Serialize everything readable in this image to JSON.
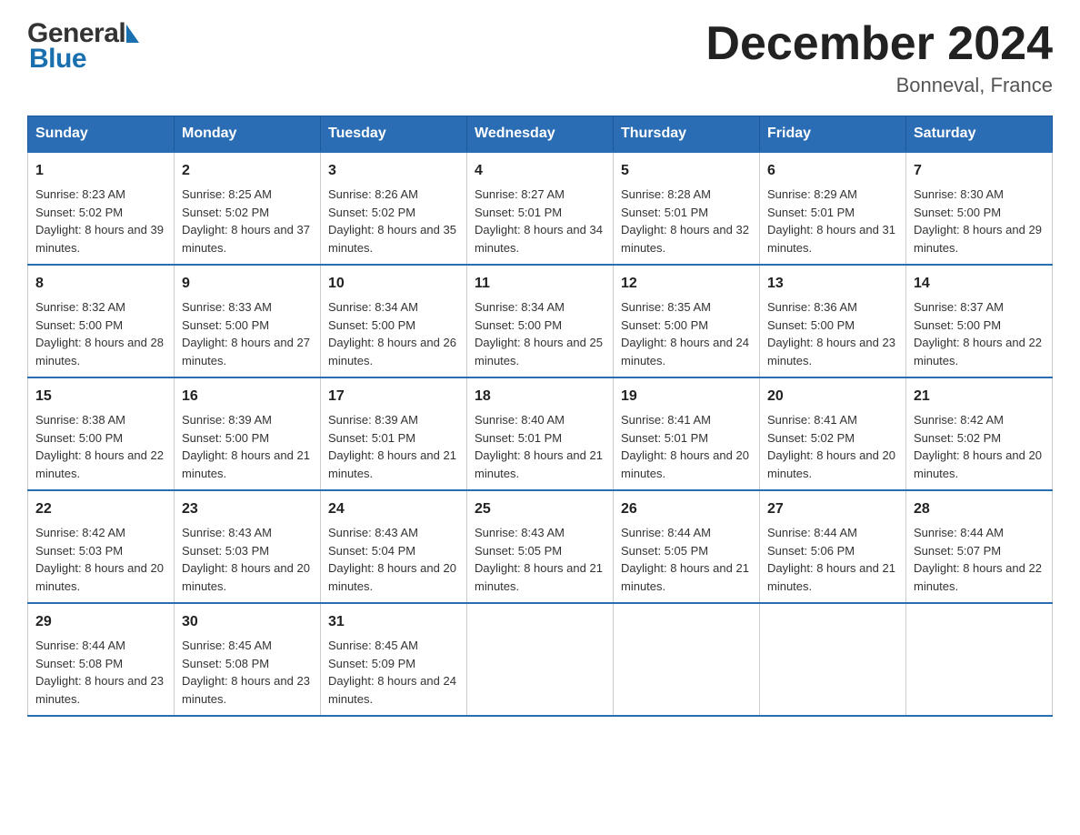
{
  "header": {
    "logo_general": "General",
    "logo_blue": "Blue",
    "title": "December 2024",
    "location": "Bonneval, France"
  },
  "calendar": {
    "days": [
      "Sunday",
      "Monday",
      "Tuesday",
      "Wednesday",
      "Thursday",
      "Friday",
      "Saturday"
    ],
    "weeks": [
      [
        {
          "day": "1",
          "sunrise": "8:23 AM",
          "sunset": "5:02 PM",
          "daylight": "8 hours and 39 minutes."
        },
        {
          "day": "2",
          "sunrise": "8:25 AM",
          "sunset": "5:02 PM",
          "daylight": "8 hours and 37 minutes."
        },
        {
          "day": "3",
          "sunrise": "8:26 AM",
          "sunset": "5:02 PM",
          "daylight": "8 hours and 35 minutes."
        },
        {
          "day": "4",
          "sunrise": "8:27 AM",
          "sunset": "5:01 PM",
          "daylight": "8 hours and 34 minutes."
        },
        {
          "day": "5",
          "sunrise": "8:28 AM",
          "sunset": "5:01 PM",
          "daylight": "8 hours and 32 minutes."
        },
        {
          "day": "6",
          "sunrise": "8:29 AM",
          "sunset": "5:01 PM",
          "daylight": "8 hours and 31 minutes."
        },
        {
          "day": "7",
          "sunrise": "8:30 AM",
          "sunset": "5:00 PM",
          "daylight": "8 hours and 29 minutes."
        }
      ],
      [
        {
          "day": "8",
          "sunrise": "8:32 AM",
          "sunset": "5:00 PM",
          "daylight": "8 hours and 28 minutes."
        },
        {
          "day": "9",
          "sunrise": "8:33 AM",
          "sunset": "5:00 PM",
          "daylight": "8 hours and 27 minutes."
        },
        {
          "day": "10",
          "sunrise": "8:34 AM",
          "sunset": "5:00 PM",
          "daylight": "8 hours and 26 minutes."
        },
        {
          "day": "11",
          "sunrise": "8:34 AM",
          "sunset": "5:00 PM",
          "daylight": "8 hours and 25 minutes."
        },
        {
          "day": "12",
          "sunrise": "8:35 AM",
          "sunset": "5:00 PM",
          "daylight": "8 hours and 24 minutes."
        },
        {
          "day": "13",
          "sunrise": "8:36 AM",
          "sunset": "5:00 PM",
          "daylight": "8 hours and 23 minutes."
        },
        {
          "day": "14",
          "sunrise": "8:37 AM",
          "sunset": "5:00 PM",
          "daylight": "8 hours and 22 minutes."
        }
      ],
      [
        {
          "day": "15",
          "sunrise": "8:38 AM",
          "sunset": "5:00 PM",
          "daylight": "8 hours and 22 minutes."
        },
        {
          "day": "16",
          "sunrise": "8:39 AM",
          "sunset": "5:00 PM",
          "daylight": "8 hours and 21 minutes."
        },
        {
          "day": "17",
          "sunrise": "8:39 AM",
          "sunset": "5:01 PM",
          "daylight": "8 hours and 21 minutes."
        },
        {
          "day": "18",
          "sunrise": "8:40 AM",
          "sunset": "5:01 PM",
          "daylight": "8 hours and 21 minutes."
        },
        {
          "day": "19",
          "sunrise": "8:41 AM",
          "sunset": "5:01 PM",
          "daylight": "8 hours and 20 minutes."
        },
        {
          "day": "20",
          "sunrise": "8:41 AM",
          "sunset": "5:02 PM",
          "daylight": "8 hours and 20 minutes."
        },
        {
          "day": "21",
          "sunrise": "8:42 AM",
          "sunset": "5:02 PM",
          "daylight": "8 hours and 20 minutes."
        }
      ],
      [
        {
          "day": "22",
          "sunrise": "8:42 AM",
          "sunset": "5:03 PM",
          "daylight": "8 hours and 20 minutes."
        },
        {
          "day": "23",
          "sunrise": "8:43 AM",
          "sunset": "5:03 PM",
          "daylight": "8 hours and 20 minutes."
        },
        {
          "day": "24",
          "sunrise": "8:43 AM",
          "sunset": "5:04 PM",
          "daylight": "8 hours and 20 minutes."
        },
        {
          "day": "25",
          "sunrise": "8:43 AM",
          "sunset": "5:05 PM",
          "daylight": "8 hours and 21 minutes."
        },
        {
          "day": "26",
          "sunrise": "8:44 AM",
          "sunset": "5:05 PM",
          "daylight": "8 hours and 21 minutes."
        },
        {
          "day": "27",
          "sunrise": "8:44 AM",
          "sunset": "5:06 PM",
          "daylight": "8 hours and 21 minutes."
        },
        {
          "day": "28",
          "sunrise": "8:44 AM",
          "sunset": "5:07 PM",
          "daylight": "8 hours and 22 minutes."
        }
      ],
      [
        {
          "day": "29",
          "sunrise": "8:44 AM",
          "sunset": "5:08 PM",
          "daylight": "8 hours and 23 minutes."
        },
        {
          "day": "30",
          "sunrise": "8:45 AM",
          "sunset": "5:08 PM",
          "daylight": "8 hours and 23 minutes."
        },
        {
          "day": "31",
          "sunrise": "8:45 AM",
          "sunset": "5:09 PM",
          "daylight": "8 hours and 24 minutes."
        },
        null,
        null,
        null,
        null
      ]
    ],
    "labels": {
      "sunrise": "Sunrise:",
      "sunset": "Sunset:",
      "daylight": "Daylight:"
    }
  }
}
